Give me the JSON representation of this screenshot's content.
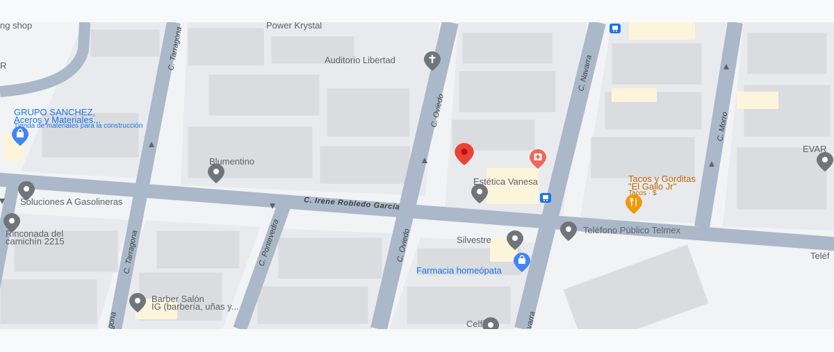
{
  "colors": {
    "road": "#aab8c9",
    "block": "#e8eaed",
    "building": "#dadce0",
    "pin_gray": "#70757a",
    "pin_blue": "#4285f4",
    "pin_orange": "#f29900",
    "pin_red": "#ea4335",
    "pin_pink": "#ee675c",
    "bus": "#1a73e8",
    "commercial": "#fdf4dc"
  },
  "icons": {
    "place": "place-pin-icon",
    "shop": "shopping-bag-icon",
    "religion": "cross-icon",
    "restaurant": "fork-knife-icon",
    "health": "medical-icon",
    "transit": "bus-stop-icon",
    "direction": "one-way-arrow-icon",
    "selected": "location-marker-icon"
  },
  "streets": {
    "tarragona_north": "C. Tarragona",
    "tarragona_south": "C. Tarragona",
    "tarragona_cut": "gona",
    "pontevedra": "C. Pontevedra",
    "oviedo_north": "C. Oviedo",
    "oviedo_south": "C. Oviedo",
    "navarra_north": "C. Navarra",
    "navarra_cut": "varra",
    "morro": "C. Morro",
    "irene": "C. Irene Robledo García"
  },
  "places": {
    "ng_shop": "ng shop",
    "r_cut": "R",
    "power_krystal": "Power Krystal",
    "auditorio": "Auditorio Libertad",
    "grupo_sanchez_1": "GRUPO SANCHEZ,",
    "grupo_sanchez_2": "Aceros y Materiales...",
    "grupo_sanchez_sub": "Tienda de materiales para la construcción",
    "blumentino": "Blumentino",
    "soluciones": "Soluciones A Gasolineras",
    "rinconada_1": "Rinconada del",
    "rinconada_2": "camichín 2215",
    "estetica": "Estética Vanesa",
    "tacos_1": "Tacos y Gorditas",
    "tacos_2": "\"El Gallo Jr\"",
    "tacos_sub": "Tacos · $",
    "evar": "EVAR",
    "telefono": "Teléfono Público Telmex",
    "telef_cut": "Teléf",
    "silvestre": "Silvestre",
    "farmacia": "Farmacia homeópata",
    "barber_1": "Barber Salón",
    "barber_2": "IG (barbería, uñas y...",
    "celfix": "Celfix"
  }
}
